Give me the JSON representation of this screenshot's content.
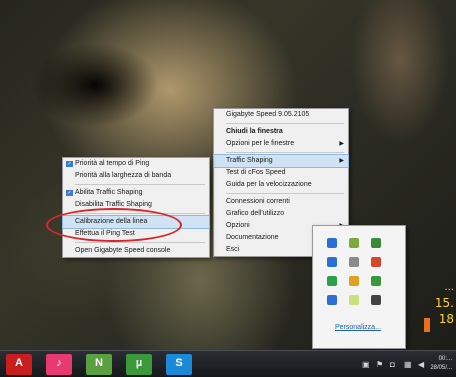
{
  "main_menu": {
    "items": [
      {
        "label": "Gigabyte Speed 9.05.2105",
        "bold": false,
        "sep_after": true
      },
      {
        "label": "Chiudi la finestra",
        "bold": true
      },
      {
        "label": "Opzioni per le finestre",
        "submenu": true,
        "sep_after": true
      },
      {
        "label": "Traffic Shaping",
        "submenu": true,
        "highlighted": true
      },
      {
        "label": "Test di cFos Speed"
      },
      {
        "label": "Guida per la velocizzazione",
        "sep_after": true
      },
      {
        "label": "Connessioni correnti"
      },
      {
        "label": "Grafico dell'utilizzo"
      },
      {
        "label": "Opzioni",
        "submenu": true
      },
      {
        "label": "Documentazione"
      },
      {
        "label": "Esci"
      }
    ]
  },
  "sub_menu": {
    "items": [
      {
        "label": "Priorità al tempo di Ping",
        "checked": true
      },
      {
        "label": "Priorità alla larghezza di banda",
        "sep_after": true
      },
      {
        "label": "Abilita Traffic Shaping",
        "checked": true
      },
      {
        "label": "Disabilita Traffic Shaping",
        "sep_after": true
      },
      {
        "label": "Calibrazione della linea",
        "highlighted": true
      },
      {
        "label": "Effettua il Ping Test",
        "sep_after": true
      },
      {
        "label": "Open Gigabyte Speed console"
      }
    ]
  },
  "tray_panel": {
    "personalize_label": "Personalizza...",
    "icons": [
      {
        "name": "bluetooth-icon",
        "color": "#2a6fd6"
      },
      {
        "name": "network-icon",
        "color": "#7ea83a"
      },
      {
        "name": "defender-icon",
        "color": "#3a8a3a"
      },
      {
        "name": "antivirus-icon",
        "color": "#2a6fd6"
      },
      {
        "name": "cloud-icon",
        "color": "#8a8a8a"
      },
      {
        "name": "chrome-icon",
        "color": "#d8452b"
      },
      {
        "name": "app-icon",
        "color": "#2aa04a"
      },
      {
        "name": "media-icon",
        "color": "#e0a020"
      },
      {
        "name": "xbox-icon",
        "color": "#3a9a3a"
      },
      {
        "name": "sync-icon",
        "color": "#2a6fd6"
      },
      {
        "name": "note-icon",
        "color": "#c8e078"
      },
      {
        "name": "speed-icon",
        "color": "#444444"
      }
    ]
  },
  "taskbar": {
    "apps": [
      {
        "name": "acrobat-button",
        "color": "#c81e1e",
        "glyph": "A"
      },
      {
        "name": "itunes-button",
        "color": "#e83a70",
        "glyph": "♪"
      },
      {
        "name": "app-n-button",
        "color": "#5aa040",
        "glyph": "N"
      },
      {
        "name": "utorrent-button",
        "color": "#3a9a3a",
        "glyph": "µ"
      },
      {
        "name": "skype-button",
        "color": "#1a8ad8",
        "glyph": "S"
      }
    ],
    "clock_time": "00:...",
    "clock_date": "28/05/..."
  },
  "side_info": {
    "line1": "...",
    "line2": "15.",
    "line3": "18"
  }
}
